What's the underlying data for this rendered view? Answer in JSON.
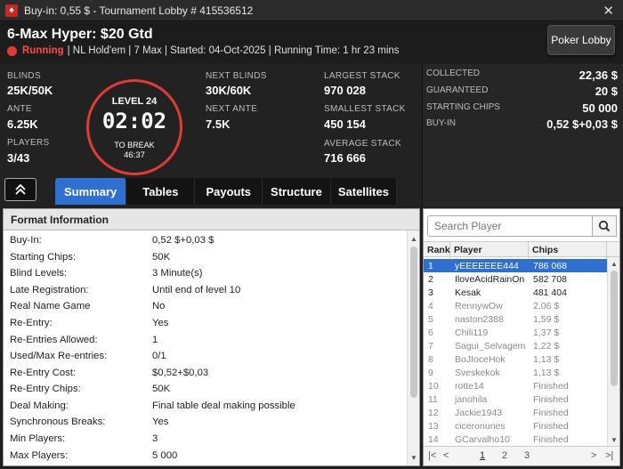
{
  "window": {
    "title": "Buy-in: 0,55 $ - Tournament Lobby # 415536512",
    "close_glyph": "✕"
  },
  "header": {
    "name": "6-Max Hyper: $20 Gtd",
    "status": "Running",
    "details": "| NL Hold'em | 7 Max | Started: 04-Oct-2025 | Running Time: 1 hr  23 mins",
    "lobby_button": "Poker Lobby"
  },
  "stats": {
    "blinds_label": "BLINDS",
    "blinds_value": "25K/50K",
    "ante_label": "ANTE",
    "ante_value": "6.25K",
    "players_label": "PLAYERS",
    "players_value": "3/43",
    "level_label": "LEVEL 24",
    "clock": "02:02",
    "break_label": "TO BREAK",
    "break_time": "46:37",
    "next_blinds_label": "NEXT BLINDS",
    "next_blinds_value": "30K/60K",
    "next_ante_label": "NEXT ANTE",
    "next_ante_value": "7.5K",
    "largest_label": "LARGEST STACK",
    "largest_value": "970 028",
    "smallest_label": "SMALLEST STACK",
    "smallest_value": "450 154",
    "average_label": "AVERAGE STACK",
    "average_value": "716 666"
  },
  "prize": {
    "collected_label": "COLLECTED",
    "collected_value": "22,36 $",
    "guaranteed_label": "GUARANTEED",
    "guaranteed_value": "20 $",
    "starting_label": "STARTING CHIPS",
    "starting_value": "50 000",
    "buyin_label": "BUY-IN",
    "buyin_value": "0,52 $+0,03 $"
  },
  "tabs": [
    "Summary",
    "Tables",
    "Payouts",
    "Structure",
    "Satellites"
  ],
  "format": {
    "title": "Format Information",
    "rows": [
      {
        "k": "Buy-In:",
        "v": "0,52 $+0,03 $"
      },
      {
        "k": "Starting Chips:",
        "v": "50K"
      },
      {
        "k": "Blind Levels:",
        "v": "3 Minute(s)"
      },
      {
        "k": "Late Registration:",
        "v": "Until end of level 10"
      },
      {
        "k": "Real Name Game",
        "v": "No"
      },
      {
        "k": "Re-Entry:",
        "v": "Yes"
      },
      {
        "k": "Re-Entries Allowed:",
        "v": "1"
      },
      {
        "k": "Used/Max Re-entries:",
        "v": "0/1"
      },
      {
        "k": "Re-Entry Cost:",
        "v": "$0,52+$0,03"
      },
      {
        "k": "Re-Entry Chips:",
        "v": "50K"
      },
      {
        "k": "Deal Making:",
        "v": "Final table deal making possible"
      },
      {
        "k": "Synchronous Breaks:",
        "v": "Yes"
      },
      {
        "k": "Min Players:",
        "v": "3"
      },
      {
        "k": "Max Players:",
        "v": "5 000"
      }
    ]
  },
  "players": {
    "search_placeholder": "Search Player",
    "headers": {
      "rank": "Rank",
      "player": "Player",
      "chips": "Chips"
    },
    "rows": [
      {
        "rank": "1",
        "name": "yEEEEEEE444",
        "chips": "786 068",
        "state": "selected"
      },
      {
        "rank": "2",
        "name": "IloveAcidRainOn",
        "chips": "582 708",
        "state": "active"
      },
      {
        "rank": "3",
        "name": "Kesak",
        "chips": "481 404",
        "state": "active"
      },
      {
        "rank": "4",
        "name": "RennywOw",
        "chips": "2,06 $",
        "state": "out"
      },
      {
        "rank": "5",
        "name": "naston2388",
        "chips": "1,59 $",
        "state": "out"
      },
      {
        "rank": "6",
        "name": "Chili119",
        "chips": "1,37 $",
        "state": "out"
      },
      {
        "rank": "7",
        "name": "Sagui_Selvagem",
        "chips": "1,22 $",
        "state": "out"
      },
      {
        "rank": "8",
        "name": "BoJIoceHok",
        "chips": "1,13 $",
        "state": "out"
      },
      {
        "rank": "9",
        "name": "Sveskekok",
        "chips": "1,13 $",
        "state": "out"
      },
      {
        "rank": "10",
        "name": "rotte14",
        "chips": "Finished",
        "state": "out"
      },
      {
        "rank": "11",
        "name": "janohila",
        "chips": "Finished",
        "state": "out"
      },
      {
        "rank": "12",
        "name": "Jackie1943",
        "chips": "Finished",
        "state": "out"
      },
      {
        "rank": "13",
        "name": "ciceronunes",
        "chips": "Finished",
        "state": "out"
      },
      {
        "rank": "14",
        "name": "GCarvalho10",
        "chips": "Finished",
        "state": "out"
      }
    ],
    "pages": [
      "1",
      "2",
      "3"
    ],
    "current_page": "1"
  },
  "icons": {
    "collapse": "chevron-double-up-icon",
    "search": "search-icon",
    "status": "status-dot-icon",
    "pager_first": "first-page-icon",
    "pager_prev": "prev-page-icon",
    "pager_next": "next-page-icon",
    "pager_last": "last-page-icon"
  },
  "colors": {
    "accent": "#2f6fcf",
    "running": "#e53935"
  }
}
